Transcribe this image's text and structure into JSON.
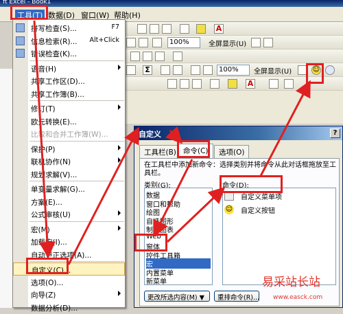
{
  "title_fragment": "ft Excel - Book1",
  "menubar": {
    "items": [
      "工具(T)",
      "数据(D)",
      "窗口(W)",
      "帮助(H)"
    ]
  },
  "toolbar": {
    "zoom": "100%",
    "fullscreen": "全屏显示(U)",
    "zoom2": "100%",
    "fullscreen2": "全屏显示(U)"
  },
  "tools_menu": {
    "items": [
      {
        "label": "拼写检查(S)...",
        "shortcut": "F7",
        "icon": "spellcheck-icon"
      },
      {
        "label": "信息检索(R)...",
        "shortcut": "Alt+Click",
        "icon": "research-icon"
      },
      {
        "label": "错误检查(K)...",
        "shortcut": "",
        "icon": "error-check-icon"
      },
      {
        "label": "语音(H)",
        "shortcut": "",
        "submenu": true
      },
      {
        "label": "共享工作区(D)...",
        "shortcut": ""
      },
      {
        "label": "共享工作簿(B)...",
        "shortcut": ""
      },
      {
        "label": "修订(T)",
        "shortcut": "",
        "submenu": true
      },
      {
        "label": "欧元转换(E)...",
        "shortcut": ""
      },
      {
        "label": "比较和合并工作簿(W)...",
        "shortcut": "",
        "disabled": true
      },
      {
        "label": "保护(P)",
        "shortcut": "",
        "submenu": true
      },
      {
        "label": "联机协作(N)",
        "shortcut": "",
        "submenu": true
      },
      {
        "label": "规划求解(V)...",
        "shortcut": ""
      },
      {
        "label": "单变量求解(G)...",
        "shortcut": ""
      },
      {
        "label": "方案(E)...",
        "shortcut": ""
      },
      {
        "label": "公式审核(U)",
        "shortcut": "",
        "submenu": true
      },
      {
        "label": "宏(M)",
        "shortcut": "",
        "submenu": true
      },
      {
        "label": "加载宏(I)...",
        "shortcut": ""
      },
      {
        "label": "自动更正选项(A)...",
        "shortcut": ""
      },
      {
        "label": "自定义(C)...",
        "shortcut": "",
        "selected": true
      },
      {
        "label": "选项(O)...",
        "shortcut": ""
      },
      {
        "label": "向导(Z)",
        "shortcut": "",
        "submenu": true
      },
      {
        "label": "数据分析(D)...",
        "shortcut": ""
      }
    ]
  },
  "dialog": {
    "title": "自定义",
    "help": "?",
    "tabs": [
      "工具栏(B)",
      "命令(C)",
      "选项(O)"
    ],
    "instruction": "在工具栏中添加新命令：选择类别并将命令从此对话框拖放至工具栏。",
    "categories_label": "类别(G):",
    "commands_label": "命令(D):",
    "categories": [
      "数据",
      "窗口和帮助",
      "绘图",
      "自选图形",
      "制作图表",
      "Web",
      "窗体",
      "控件工具箱",
      "宏",
      "内置菜单",
      "新菜单"
    ],
    "selected_category": "宏",
    "commands": [
      {
        "label": "自定义菜单项",
        "icon": "menu-item-icon"
      },
      {
        "label": "自定义按钮",
        "icon": "smiley-icon"
      }
    ],
    "modify_button": "更改所选内容(M) ▼",
    "rearrange_button": "重排命令(R)..."
  },
  "watermark": {
    "text": "易采站长站",
    "url": "www.easck.com"
  },
  "colors": {
    "highlight_red": "#e02020",
    "menu_selected_bg": "#fff4c0",
    "category_selected_bg": "#316ac5"
  }
}
